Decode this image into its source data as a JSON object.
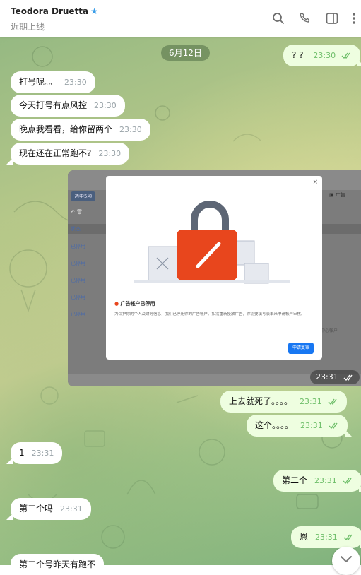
{
  "header": {
    "name": "Teodora Druetta",
    "status": "近期上线",
    "icons": [
      "search-icon",
      "phone-icon",
      "sidebar-toggle-icon",
      "more-vert-icon"
    ]
  },
  "date_chip": "6月12日",
  "messages": {
    "m0": {
      "text": "? ?",
      "time": "23:30"
    },
    "m1": {
      "text": "打号呢。。",
      "time": "23:30"
    },
    "m2": {
      "text": "今天打号有点风控",
      "time": "23:30"
    },
    "m3": {
      "text": "晚点我看看，给你留两个",
      "time": "23:30"
    },
    "m4": {
      "text": "现在还在正常跑不?",
      "time": "23:30"
    },
    "m6": {
      "text": "上去就死了。。。。",
      "time": "23:31"
    },
    "m7": {
      "text": "这个。。。。",
      "time": "23:31"
    },
    "m8": {
      "text": "1",
      "time": "23:31"
    },
    "m9": {
      "text": "第二个",
      "time": "23:31"
    },
    "m10": {
      "text": "第二个吗",
      "time": "23:31"
    },
    "m11": {
      "text": "恩",
      "time": "23:31"
    },
    "m12": {
      "text": "第二个号昨天有跑不",
      "time": ""
    }
  },
  "image_message": {
    "time": "23:31",
    "screenshot": {
      "chip": "选中5项",
      "col_header": "状态",
      "rows": [
        "已停用",
        "已停用",
        "已停用",
        "已停用",
        "已停用"
      ],
      "right_tab": "广告",
      "right_footer": "中心帐户",
      "dialog": {
        "title": "广告帐户已停用",
        "body": "为保护你的个人及财务信息，我们已停用你的广告帐户。如需重新投放广告，你需要填写表单来申请帐户审核。",
        "button": "申请复审"
      }
    }
  },
  "colors": {
    "accent": "#3a9de8",
    "outgoing": "#eefee0",
    "check": "#6fbf6a",
    "lock_body": "#e8461d"
  }
}
